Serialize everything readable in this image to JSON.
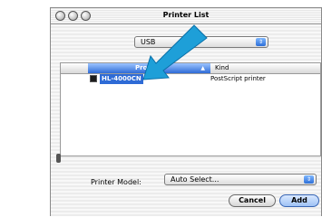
{
  "window": {
    "title": "Printer List"
  },
  "connection_popup": {
    "value": "USB"
  },
  "table": {
    "columns": [
      "Product",
      "Kind"
    ],
    "rows": [
      {
        "product": "HL-4000CN",
        "kind": "PostScript printer"
      }
    ]
  },
  "printer_model": {
    "label": "Printer Model:",
    "value": "Auto Select..."
  },
  "buttons": {
    "cancel": "Cancel",
    "add": "Add"
  },
  "colors": {
    "selection": "#2e6bd6",
    "arrow": "#1e9fd8",
    "default_button": "#9fc2f5"
  }
}
